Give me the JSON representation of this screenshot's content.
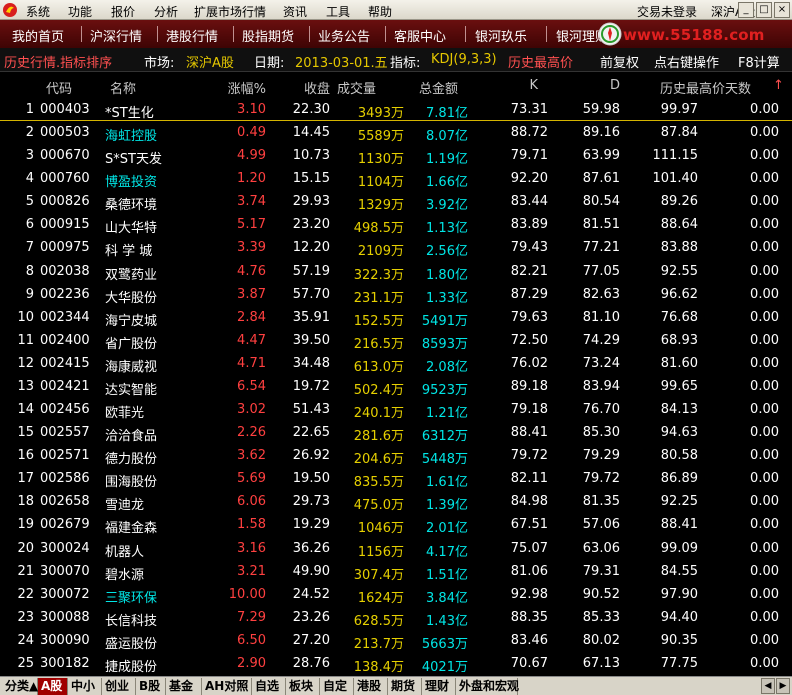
{
  "menubar": {
    "items": [
      "系统",
      "功能",
      "报价",
      "分析",
      "扩展市场行情",
      "资讯",
      "工具",
      "帮助"
    ],
    "status": "交易未登录",
    "market": "深沪A股",
    "window_buttons": [
      "_",
      "□",
      "×"
    ]
  },
  "navbar": {
    "items": [
      "我的首页",
      "沪深行情",
      "港股行情",
      "股指期货",
      "业务公告",
      "客服中心",
      "银河玖乐",
      "银河理财"
    ],
    "brand_url": "www.55188.com"
  },
  "infobar": {
    "title": "历史行情.指标排序",
    "market_label": "市场:",
    "market_value": "深沪A股",
    "date_label": "日期:",
    "date_value": "2013-03-01.五",
    "indicator_label": "指标:",
    "indicator_value": "KDJ(9,3,3)",
    "sort_label": "历史最高价",
    "adjust": "前复权",
    "hint": "点右键操作",
    "f8": "F8计算"
  },
  "table": {
    "headers": [
      "代码",
      "名称",
      "涨幅%",
      "收盘",
      "成交量",
      "总金额",
      "K",
      "D",
      "历史最高价天数"
    ],
    "sort_arrow": "↑",
    "rows": [
      {
        "idx": "1",
        "code": "000403",
        "name": "*ST生化",
        "chg": "3.10",
        "close": "22.30",
        "vol": "3493",
        "vol_unit": "万",
        "amt": "7.81",
        "amt_unit": "亿",
        "k": "73.31",
        "d": "59.98",
        "high": "99.97",
        "days": "0.00",
        "name_color": "#ffffff"
      },
      {
        "idx": "2",
        "code": "000503",
        "name": "海虹控股",
        "chg": "0.49",
        "close": "14.45",
        "vol": "5589",
        "vol_unit": "万",
        "amt": "8.07",
        "amt_unit": "亿",
        "k": "88.72",
        "d": "89.16",
        "high": "87.84",
        "days": "0.00",
        "name_color": "#00e6e6"
      },
      {
        "idx": "3",
        "code": "000670",
        "name": "S*ST天发",
        "chg": "4.99",
        "close": "10.73",
        "vol": "1130",
        "vol_unit": "万",
        "amt": "1.19",
        "amt_unit": "亿",
        "k": "79.71",
        "d": "63.99",
        "high": "111.15",
        "days": "0.00",
        "name_color": "#ffffff"
      },
      {
        "idx": "4",
        "code": "000760",
        "name": "博盈投资",
        "chg": "1.20",
        "close": "15.15",
        "vol": "1104",
        "vol_unit": "万",
        "amt": "1.66",
        "amt_unit": "亿",
        "k": "92.20",
        "d": "87.61",
        "high": "101.40",
        "days": "0.00",
        "name_color": "#00e6e6"
      },
      {
        "idx": "5",
        "code": "000826",
        "name": "桑德环境",
        "chg": "3.74",
        "close": "29.93",
        "vol": "1329",
        "vol_unit": "万",
        "amt": "3.92",
        "amt_unit": "亿",
        "k": "83.44",
        "d": "80.54",
        "high": "89.26",
        "days": "0.00",
        "name_color": "#ffffff"
      },
      {
        "idx": "6",
        "code": "000915",
        "name": "山大华特",
        "chg": "5.17",
        "close": "23.20",
        "vol": "498.5",
        "vol_unit": "万",
        "amt": "1.13",
        "amt_unit": "亿",
        "k": "83.89",
        "d": "81.51",
        "high": "88.64",
        "days": "0.00",
        "name_color": "#ffffff"
      },
      {
        "idx": "7",
        "code": "000975",
        "name": "科 学 城",
        "chg": "3.39",
        "close": "12.20",
        "vol": "2109",
        "vol_unit": "万",
        "amt": "2.56",
        "amt_unit": "亿",
        "k": "79.43",
        "d": "77.21",
        "high": "83.88",
        "days": "0.00",
        "name_color": "#ffffff"
      },
      {
        "idx": "8",
        "code": "002038",
        "name": "双鹭药业",
        "chg": "4.76",
        "close": "57.19",
        "vol": "322.3",
        "vol_unit": "万",
        "amt": "1.80",
        "amt_unit": "亿",
        "k": "82.21",
        "d": "77.05",
        "high": "92.55",
        "days": "0.00",
        "name_color": "#ffffff"
      },
      {
        "idx": "9",
        "code": "002236",
        "name": "大华股份",
        "chg": "3.87",
        "close": "57.70",
        "vol": "231.1",
        "vol_unit": "万",
        "amt": "1.33",
        "amt_unit": "亿",
        "k": "87.29",
        "d": "82.63",
        "high": "96.62",
        "days": "0.00",
        "name_color": "#ffffff"
      },
      {
        "idx": "10",
        "code": "002344",
        "name": "海宁皮城",
        "chg": "2.84",
        "close": "35.91",
        "vol": "152.5",
        "vol_unit": "万",
        "amt": "5491",
        "amt_unit": "万",
        "k": "79.63",
        "d": "81.10",
        "high": "76.68",
        "days": "0.00",
        "name_color": "#ffffff"
      },
      {
        "idx": "11",
        "code": "002400",
        "name": "省广股份",
        "chg": "4.47",
        "close": "39.50",
        "vol": "216.5",
        "vol_unit": "万",
        "amt": "8593",
        "amt_unit": "万",
        "k": "72.50",
        "d": "74.29",
        "high": "68.93",
        "days": "0.00",
        "name_color": "#ffffff"
      },
      {
        "idx": "12",
        "code": "002415",
        "name": "海康威视",
        "chg": "4.71",
        "close": "34.48",
        "vol": "613.0",
        "vol_unit": "万",
        "amt": "2.08",
        "amt_unit": "亿",
        "k": "76.02",
        "d": "73.24",
        "high": "81.60",
        "days": "0.00",
        "name_color": "#ffffff"
      },
      {
        "idx": "13",
        "code": "002421",
        "name": "达实智能",
        "chg": "6.54",
        "close": "19.72",
        "vol": "502.4",
        "vol_unit": "万",
        "amt": "9523",
        "amt_unit": "万",
        "k": "89.18",
        "d": "83.94",
        "high": "99.65",
        "days": "0.00",
        "name_color": "#ffffff"
      },
      {
        "idx": "14",
        "code": "002456",
        "name": "欧菲光",
        "chg": "3.02",
        "close": "51.43",
        "vol": "240.1",
        "vol_unit": "万",
        "amt": "1.21",
        "amt_unit": "亿",
        "k": "79.18",
        "d": "76.70",
        "high": "84.13",
        "days": "0.00",
        "name_color": "#ffffff"
      },
      {
        "idx": "15",
        "code": "002557",
        "name": "洽洽食品",
        "chg": "2.26",
        "close": "22.65",
        "vol": "281.6",
        "vol_unit": "万",
        "amt": "6312",
        "amt_unit": "万",
        "k": "88.41",
        "d": "85.30",
        "high": "94.63",
        "days": "0.00",
        "name_color": "#ffffff"
      },
      {
        "idx": "16",
        "code": "002571",
        "name": "德力股份",
        "chg": "3.62",
        "close": "26.92",
        "vol": "204.6",
        "vol_unit": "万",
        "amt": "5448",
        "amt_unit": "万",
        "k": "79.72",
        "d": "79.29",
        "high": "80.58",
        "days": "0.00",
        "name_color": "#ffffff"
      },
      {
        "idx": "17",
        "code": "002586",
        "name": "围海股份",
        "chg": "5.69",
        "close": "19.50",
        "vol": "835.5",
        "vol_unit": "万",
        "amt": "1.61",
        "amt_unit": "亿",
        "k": "82.11",
        "d": "79.72",
        "high": "86.89",
        "days": "0.00",
        "name_color": "#ffffff"
      },
      {
        "idx": "18",
        "code": "002658",
        "name": "雪迪龙",
        "chg": "6.06",
        "close": "29.73",
        "vol": "475.0",
        "vol_unit": "万",
        "amt": "1.39",
        "amt_unit": "亿",
        "k": "84.98",
        "d": "81.35",
        "high": "92.25",
        "days": "0.00",
        "name_color": "#ffffff"
      },
      {
        "idx": "19",
        "code": "002679",
        "name": "福建金森",
        "chg": "1.58",
        "close": "19.29",
        "vol": "1046",
        "vol_unit": "万",
        "amt": "2.01",
        "amt_unit": "亿",
        "k": "67.51",
        "d": "57.06",
        "high": "88.41",
        "days": "0.00",
        "name_color": "#ffffff"
      },
      {
        "idx": "20",
        "code": "300024",
        "name": "机器人",
        "chg": "3.16",
        "close": "36.26",
        "vol": "1156",
        "vol_unit": "万",
        "amt": "4.17",
        "amt_unit": "亿",
        "k": "75.07",
        "d": "63.06",
        "high": "99.09",
        "days": "0.00",
        "name_color": "#ffffff"
      },
      {
        "idx": "21",
        "code": "300070",
        "name": "碧水源",
        "chg": "3.21",
        "close": "49.90",
        "vol": "307.4",
        "vol_unit": "万",
        "amt": "1.51",
        "amt_unit": "亿",
        "k": "81.06",
        "d": "79.31",
        "high": "84.55",
        "days": "0.00",
        "name_color": "#ffffff"
      },
      {
        "idx": "22",
        "code": "300072",
        "name": "三聚环保",
        "chg": "10.00",
        "close": "24.52",
        "vol": "1624",
        "vol_unit": "万",
        "amt": "3.84",
        "amt_unit": "亿",
        "k": "92.98",
        "d": "90.52",
        "high": "97.90",
        "days": "0.00",
        "name_color": "#00e6e6"
      },
      {
        "idx": "23",
        "code": "300088",
        "name": "长信科技",
        "chg": "7.29",
        "close": "23.26",
        "vol": "628.5",
        "vol_unit": "万",
        "amt": "1.43",
        "amt_unit": "亿",
        "k": "88.35",
        "d": "85.33",
        "high": "94.40",
        "days": "0.00",
        "name_color": "#ffffff"
      },
      {
        "idx": "24",
        "code": "300090",
        "name": "盛运股份",
        "chg": "6.50",
        "close": "27.20",
        "vol": "213.7",
        "vol_unit": "万",
        "amt": "5663",
        "amt_unit": "万",
        "k": "83.46",
        "d": "80.02",
        "high": "90.35",
        "days": "0.00",
        "name_color": "#ffffff"
      },
      {
        "idx": "25",
        "code": "300182",
        "name": "捷成股份",
        "chg": "2.90",
        "close": "28.76",
        "vol": "138.4",
        "vol_unit": "万",
        "amt": "4021",
        "amt_unit": "万",
        "k": "70.67",
        "d": "67.13",
        "high": "77.75",
        "days": "0.00",
        "name_color": "#ffffff"
      }
    ]
  },
  "tabbar": {
    "tabs": [
      "分类▲",
      "A股",
      "中小",
      "创业",
      "B股",
      "基金",
      "AH对照",
      "自选",
      "板块",
      "自定",
      "港股",
      "期货",
      "理财",
      "外盘和宏观"
    ],
    "active": 1,
    "arrows": [
      "◀",
      "▶"
    ]
  }
}
